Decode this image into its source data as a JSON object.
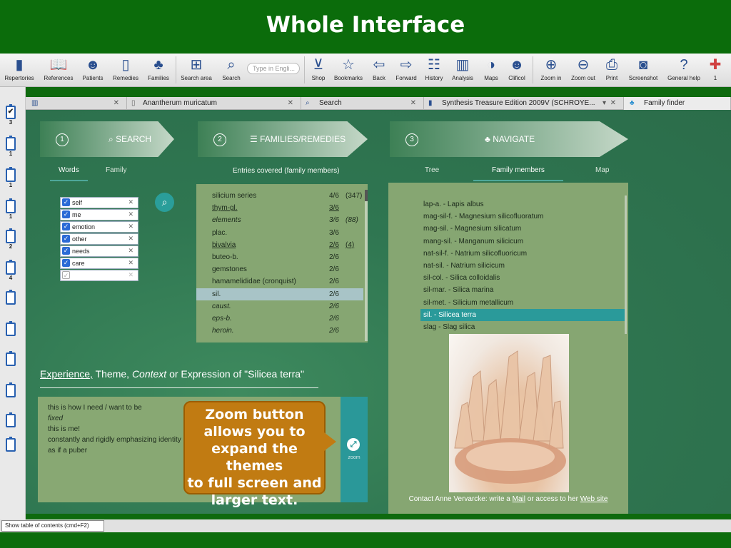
{
  "banner": {
    "title": "Whole Interface"
  },
  "toolbar": {
    "items": [
      {
        "label": "Repertories",
        "icon": "book-icon"
      },
      {
        "label": "References",
        "icon": "open-book-icon"
      },
      {
        "label": "Patients",
        "icon": "patients-icon"
      },
      {
        "label": "Remedies",
        "icon": "remedy-bottle-icon"
      },
      {
        "label": "Families",
        "icon": "family-tree-icon"
      },
      {
        "label": "Search area",
        "icon": "search-area-icon"
      },
      {
        "label": "Search",
        "icon": "search-icon"
      },
      {
        "label": "Shop",
        "icon": "cart-icon"
      },
      {
        "label": "Bookmarks",
        "icon": "star-icon"
      },
      {
        "label": "Back",
        "icon": "back-arrow-icon"
      },
      {
        "label": "Forward",
        "icon": "forward-arrow-icon"
      },
      {
        "label": "History",
        "icon": "history-icon"
      },
      {
        "label": "Analysis",
        "icon": "analysis-chart-icon"
      },
      {
        "label": "Maps",
        "icon": "maps-icon"
      },
      {
        "label": "Clificol",
        "icon": "clificol-icon"
      },
      {
        "label": "Zoom in",
        "icon": "zoom-in-icon"
      },
      {
        "label": "Zoom out",
        "icon": "zoom-out-icon"
      },
      {
        "label": "Print",
        "icon": "print-icon"
      },
      {
        "label": "Screenshot",
        "icon": "camera-icon"
      },
      {
        "label": "General help",
        "icon": "help-icon"
      },
      {
        "label": "1",
        "icon": "gift-icon"
      }
    ],
    "search_placeholder": "Type in Engli..."
  },
  "left_strip": {
    "counts": [
      "3",
      "1",
      "1",
      "1",
      "2",
      "4"
    ]
  },
  "tabs": [
    {
      "label": "",
      "icon": "chart-icon"
    },
    {
      "label": "Anantherum muricatum",
      "icon": "document-icon"
    },
    {
      "label": "Search",
      "icon": "search-icon"
    },
    {
      "label": "Synthesis Treasure Edition 2009V (SCHROYE...",
      "icon": "book-icon"
    },
    {
      "label": "Family finder",
      "icon": "family-tree-icon"
    }
  ],
  "steps": [
    {
      "num": "1",
      "title": "SEARCH"
    },
    {
      "num": "2",
      "title": "FAMILIES/REMEDIES"
    },
    {
      "num": "3",
      "title": "NAVIGATE"
    }
  ],
  "search_panel": {
    "tabs": [
      "Words",
      "Family"
    ],
    "words": [
      "self",
      "me",
      "emotion",
      "other",
      "needs",
      "care",
      ""
    ]
  },
  "families_panel": {
    "header": "Entries covered (family members)",
    "rows": [
      {
        "name": "silicium series",
        "score": "4/6",
        "count": "(347)"
      },
      {
        "name": "thym-gl.",
        "score": "3/6",
        "count": ""
      },
      {
        "name": "elements",
        "score": "3/6",
        "count": "(88)"
      },
      {
        "name": "plac.",
        "score": "3/6",
        "count": ""
      },
      {
        "name": "bivalvia",
        "score": "2/6",
        "count": "(4)"
      },
      {
        "name": "buteo-b.",
        "score": "2/6",
        "count": ""
      },
      {
        "name": "gemstones",
        "score": "2/6",
        "count": ""
      },
      {
        "name": "hamamelididae (cronquist)",
        "score": "2/6",
        "count": ""
      },
      {
        "name": "sil.",
        "score": "2/6",
        "count": ""
      },
      {
        "name": "caust.",
        "score": "2/6",
        "count": ""
      },
      {
        "name": "eps-b.",
        "score": "2/6",
        "count": ""
      },
      {
        "name": "heroin.",
        "score": "2/6",
        "count": ""
      }
    ]
  },
  "navigate_panel": {
    "tabs": [
      "Tree",
      "Family members",
      "Map"
    ],
    "members": [
      "lap-a. - Lapis albus",
      "mag-sil-f. - Magnesium silicofluoratum",
      "mag-sil. - Magnesium silicatum",
      "mang-sil. - Manganum silicicum",
      "nat-sil-f. - Natrium silicofluoricum",
      "nat-sil. - Natrium silicicum",
      "sil-col. - Silica colloidalis",
      "sil-mar. - Silica marina",
      "sil-met. - Silicium metallicum",
      "sil. - Silicea terra",
      "slag - Slag silica"
    ],
    "contact": {
      "prefix": "Contact Anne Vervarcke: write a ",
      "mail": "Mail",
      "middle": " or access to her ",
      "site": "Web site"
    }
  },
  "themes": {
    "heading_experience": "Experience,",
    "heading_theme": " Theme, ",
    "heading_context": "Context",
    "heading_rest": " or Expression of \"Silicea terra\"",
    "lines": [
      "this is how I need / want to be",
      "fixed",
      "this is me!",
      "constantly and rigidly emphasizing identity",
      "as if a puber"
    ],
    "zoom_label": "zoom"
  },
  "callout": {
    "lines": [
      "Zoom button",
      "allows you to",
      "expand the themes",
      "to full screen and",
      "larger text."
    ]
  },
  "statusbar": {
    "toc_button": "Show table of contents (cmd+F2)"
  },
  "colors": {
    "banner_green": "#0b6c0b",
    "panel_green": "#86a672",
    "teal_accent": "#2a9a9a",
    "callout_orange": "#c17b12"
  }
}
